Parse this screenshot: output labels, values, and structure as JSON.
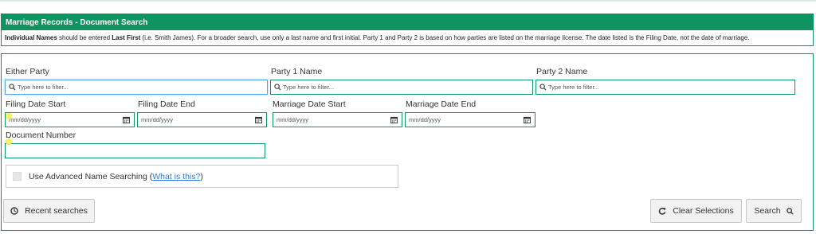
{
  "banner": {
    "title": "Marriage Records - Document Search",
    "note_bold1": "Individual Names",
    "note_t1": " should be entered ",
    "note_bold2": "Last First",
    "note_t2": " (i.e. Smith James). For a broader search, use only a last name and first initial. Party 1 and Party 2 is based on how parties are listed on the marriage license. The date listed is the Filing Date, not the date of marriage."
  },
  "fields": {
    "either_party": {
      "label": "Either Party",
      "placeholder": "Type here to filter..."
    },
    "party1": {
      "label": "Party 1 Name",
      "placeholder": "Type here to filter..."
    },
    "party2": {
      "label": "Party 2 Name",
      "placeholder": "Type here to filter..."
    },
    "filing_start": {
      "label": "Filing Date Start",
      "placeholder": "mm/dd/yyyy"
    },
    "filing_end": {
      "label": "Filing Date End",
      "placeholder": "mm/dd/yyyy"
    },
    "marriage_start": {
      "label": "Marriage Date Start",
      "placeholder": "mm/dd/yyyy"
    },
    "marriage_end": {
      "label": "Marriage Date End",
      "placeholder": "mm/dd/yyyy"
    },
    "doc_number": {
      "label": "Document Number",
      "value": ""
    }
  },
  "advanced": {
    "label": "Use Advanced Name Searching (",
    "link": "What is this?",
    "close": ")"
  },
  "buttons": {
    "recent": "Recent searches",
    "clear": "Clear Selections",
    "search": "Search"
  },
  "colors": {
    "accent": "#0e9460",
    "focus": "#58a3d6",
    "link": "#2a7ad3"
  }
}
